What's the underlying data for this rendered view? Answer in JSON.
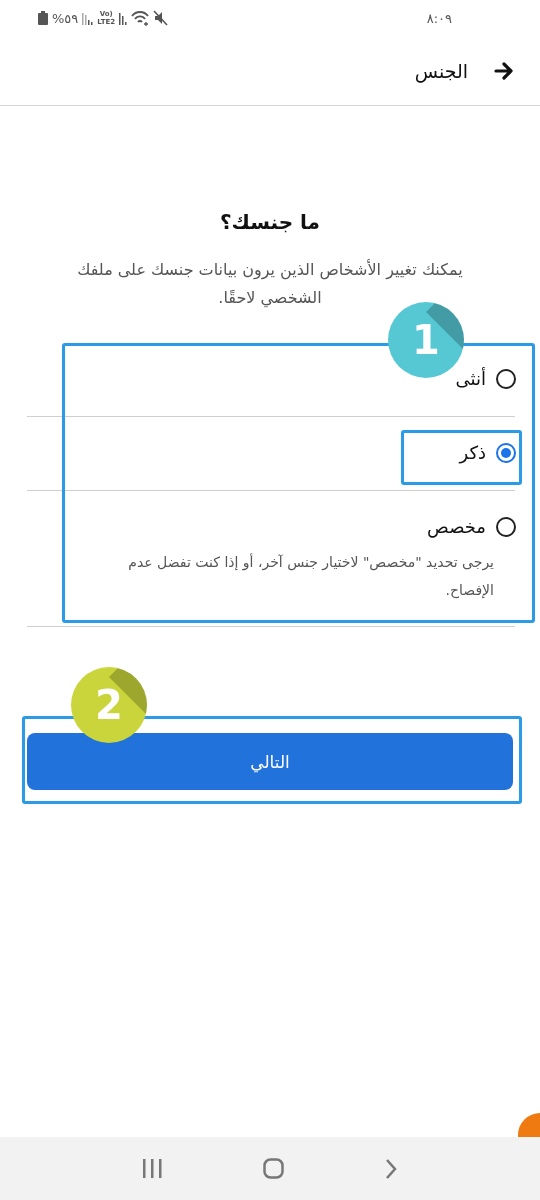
{
  "status_bar": {
    "time": "٨:٠٩",
    "battery": "%٥٩",
    "network_top": "Vo)",
    "network_bottom": "LTE2"
  },
  "header": {
    "title": "الجنس"
  },
  "question": {
    "title": "ما جنسك؟",
    "subtitle": "يمكنك تغيير الأشخاص الذين يرون بيانات جنسك على ملفك الشخصي لاحقًا."
  },
  "options": [
    {
      "label": "أنثى",
      "selected": false
    },
    {
      "label": "ذكر",
      "selected": true
    },
    {
      "label": "مخصص",
      "selected": false,
      "description": "يرجى تحديد \"مخصص\" لاختيار جنس آخر، أو إذا كنت تفضل عدم الإفصاح."
    }
  ],
  "next_button": {
    "label": "التالي"
  },
  "annotations": [
    {
      "label": "1",
      "color": "#56c8d4"
    },
    {
      "label": "2",
      "color": "#c9d53a"
    }
  ]
}
